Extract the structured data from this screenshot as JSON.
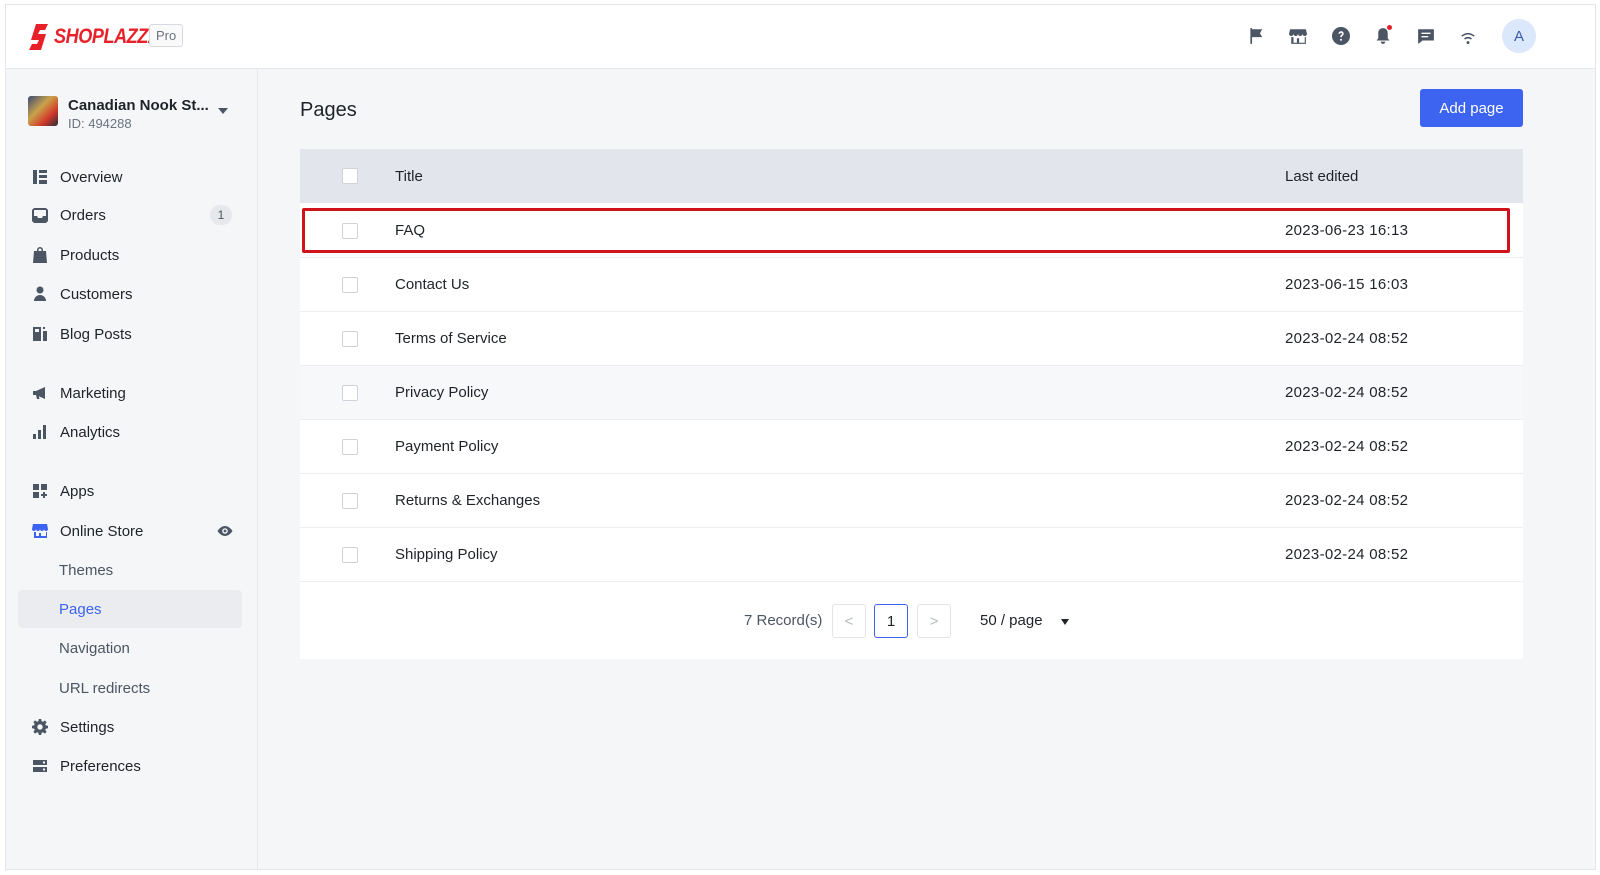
{
  "brand": {
    "name": "SHOPLAZZA",
    "plan": "Pro",
    "color": "#e8202a"
  },
  "header": {
    "icons": [
      "flag-icon",
      "store-icon",
      "help-icon",
      "bell-icon",
      "message-icon",
      "wifi-icon"
    ],
    "avatar_initial": "A"
  },
  "store": {
    "name": "Canadian Nook St...",
    "id": "ID: 494288"
  },
  "sidebar": {
    "items": [
      {
        "label": "Overview"
      },
      {
        "label": "Orders",
        "badge": "1"
      },
      {
        "label": "Products"
      },
      {
        "label": "Customers"
      },
      {
        "label": "Blog Posts"
      },
      {
        "label": "Marketing"
      },
      {
        "label": "Analytics"
      },
      {
        "label": "Apps"
      },
      {
        "label": "Online Store"
      },
      {
        "label": "Themes"
      },
      {
        "label": "Pages"
      },
      {
        "label": "Navigation"
      },
      {
        "label": "URL redirects"
      },
      {
        "label": "Settings"
      },
      {
        "label": "Preferences"
      }
    ]
  },
  "main": {
    "title": "Pages",
    "add_button": "Add page",
    "columns": {
      "title": "Title",
      "last_edited": "Last edited"
    },
    "rows": [
      {
        "title": "FAQ",
        "last_edited": "2023-06-23 16:13"
      },
      {
        "title": "Contact Us",
        "last_edited": "2023-06-15 16:03"
      },
      {
        "title": "Terms of Service",
        "last_edited": "2023-02-24 08:52"
      },
      {
        "title": "Privacy Policy",
        "last_edited": "2023-02-24 08:52"
      },
      {
        "title": "Payment Policy",
        "last_edited": "2023-02-24 08:52"
      },
      {
        "title": "Returns & Exchanges",
        "last_edited": "2023-02-24 08:52"
      },
      {
        "title": "Shipping Policy",
        "last_edited": "2023-02-24 08:52"
      }
    ],
    "pagination": {
      "records": "7 Record(s)",
      "prev": "<",
      "current_page": "1",
      "next": ">",
      "per_page": "50 / page"
    }
  },
  "colors": {
    "accent": "#3c64f0",
    "highlight": "#d0121b"
  }
}
